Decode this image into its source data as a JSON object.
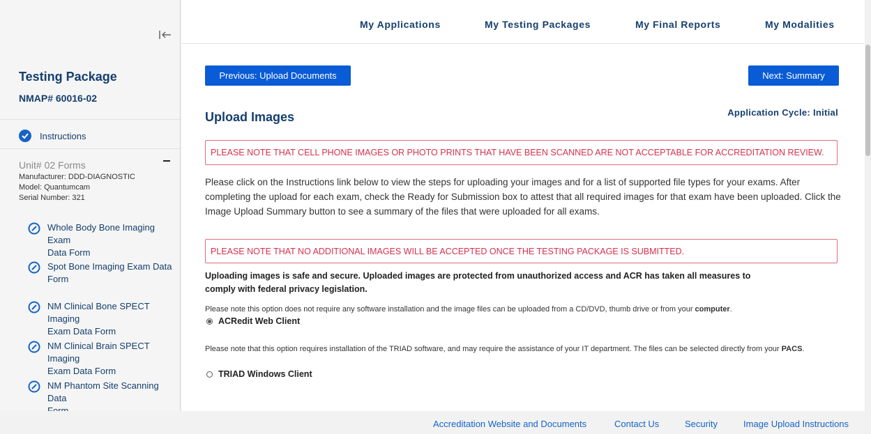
{
  "sidebar": {
    "title": "Testing Package",
    "package_id": "NMAP# 60016-02",
    "instructions_label": "Instructions",
    "unit": {
      "title": "Unit# 02 Forms",
      "manufacturer": "Manufacturer: DDD-DIAGNOSTIC",
      "model": "Model: Quantumcam",
      "serial": "Serial Number: 321"
    },
    "forms": [
      {
        "line1": "Whole Body Bone Imaging Exam",
        "line2": "Data Form"
      },
      {
        "line1": "Spot Bone Imaging Exam Data",
        "line2": "Form"
      },
      {
        "line1": "NM Clinical Bone SPECT Imaging",
        "line2": "Exam Data Form"
      },
      {
        "line1": "NM Clinical Brain SPECT Imaging",
        "line2": "Exam Data Form"
      },
      {
        "line1": "NM Phantom Site Scanning Data",
        "line2": "Form"
      }
    ]
  },
  "nav": {
    "applications": "My Applications",
    "testing_packages": "My Testing Packages",
    "final_reports": "My Final Reports",
    "modalities": "My Modalities"
  },
  "main": {
    "prev_button": "Previous: Upload Documents",
    "next_button": "Next: Summary",
    "heading": "Upload Images",
    "cycle": "Application Cycle: Initial",
    "alert1": "PLEASE NOTE THAT CELL PHONE IMAGES OR PHOTO PRINTS THAT HAVE BEEN SCANNED ARE NOT ACCEPTABLE FOR ACCREDITATION REVIEW.",
    "instructions_text": "Please click on the Instructions link below to view the steps for uploading your images and for a list of supported file types for your exams. After completing the upload for each exam, check the Ready for Submission box to attest that all required images for that exam have been uploaded. Click the Image Upload Summary button to see a summary of the files that were uploaded for all exams.",
    "alert2": "PLEASE NOTE THAT NO ADDITIONAL IMAGES WILL BE ACCEPTED ONCE THE TESTING PACKAGE IS SUBMITTED.",
    "secure_text": "Uploading images is safe and secure. Uploaded images are protected from unauthorized access and ACR has taken all measures to comply with federal privacy legislation.",
    "option1_note": "Please note this option does not require any software installation and the image files can be uploaded from a CD/DVD, thumb drive or from your ",
    "option1_note_bold": "computer",
    "option1_note_end": ".",
    "option1_label": "ACRedit Web Client",
    "option1_selected": true,
    "option2_note": "Please note that this option requires installation of the TRIAD software, and may require the assistance of your IT department. The files can be selected directly from your ",
    "option2_note_bold": "PACS",
    "option2_note_end": ".",
    "option2_label": "TRIAD Windows Client",
    "option2_selected": false
  },
  "footer": {
    "website": "Accreditation Website and Documents",
    "contact": "Contact Us",
    "security": "Security",
    "instructions": "Image Upload Instructions"
  },
  "colors": {
    "primary": "#0a5bd6",
    "heading": "#153f6e",
    "alert": "#d6304f",
    "link": "#1663c7"
  },
  "icons": {
    "collapse": "collapse-left-icon",
    "check": "check-circle-icon",
    "edit": "edit-circle-icon",
    "minus": "minus-icon"
  }
}
